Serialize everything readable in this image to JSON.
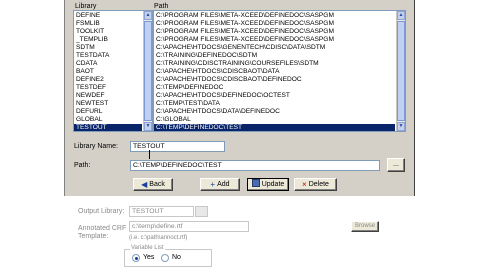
{
  "columns": {
    "library": "Library",
    "path": "Path"
  },
  "libraries": [
    "DEFINE",
    "FSMLIB",
    "TOOLKIT",
    "_TEMPLIB",
    "SDTM",
    "TESTDATA",
    "CDATA",
    "BAOT",
    "DEFINE2",
    "TESTDEF",
    "NEWDEF",
    "NEWTEST",
    "DEFURL",
    "GLOBAL",
    "TESTOUT"
  ],
  "paths": [
    "C:\\PROGRAM FILES\\META-XCEED\\DEFINEDOC\\SASPGM",
    "C:\\PROGRAM FILES\\META-XCEED\\DEFINEDOC\\SASPGM",
    "C:\\PROGRAM FILES\\META-XCEED\\DEFINEDOC\\SASPGM",
    "C:\\PROGRAM FILES\\META-XCEED\\DEFINEDOC\\SASPGM",
    "C:\\APACHE\\HTDOCS\\GENENTECH\\CDISC\\DATA\\SDTM",
    "C:\\TRAINING\\DEFINEDOC\\SDTM",
    "C:\\TRAINING\\CDISCTRAINING\\COURSEFILES\\SDTM",
    "C:\\APACHE\\HTDOCS\\CDISCBAOT\\DATA",
    "C:\\APACHE\\HTDOCS\\CDISCBAOT\\DEFINEDOC",
    "C:\\TEMP\\DEFINEDOC",
    "C:\\APACHE\\HTDOCS\\DEFINEDOC\\OCTEST",
    "C:\\TEMP\\TEST\\DATA",
    "C:\\APACHE\\HTDOCS\\DATA\\DEFINEDOC",
    "C:\\GLOBAL",
    "C:\\TEMP\\DEFINEDOC\\TEST"
  ],
  "selected_index": 14,
  "form": {
    "library_name_label": "Library Name:",
    "library_name_value": "TESTOUT",
    "path_label": "Path:",
    "path_value": "C:\\TEMP\\DEFINEDOC\\TEST",
    "browse_label": "..."
  },
  "buttons": {
    "back": "Back",
    "add": "Add",
    "update": "Update",
    "delete": "Delete"
  },
  "below": {
    "output_library_label": "Output Library:",
    "output_library_value": "TESTOUT",
    "annotated_crf_label": "Annotated CRF",
    "template_label": "Template:",
    "annotated_crf_value": "c:\\temp\\define.rtf",
    "hint": "(i.e. c:\\path\\annoct.rtf)",
    "browse_label": "Browse",
    "variable_list_label": "Variable List",
    "yes_label": "Yes",
    "no_label": "No"
  },
  "colors": {
    "panel": "#d4d0c8",
    "selection": "#0a246a",
    "border": "#7f9db9"
  }
}
